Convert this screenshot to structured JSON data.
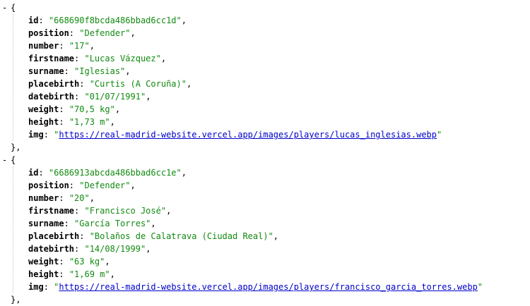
{
  "records": [
    {
      "toggle": "-",
      "open": "{",
      "close": "},",
      "fields": [
        {
          "key": "id",
          "value": "\"668690f8bcda486bbad6cc1d\"",
          "is_link": false
        },
        {
          "key": "position",
          "value": "\"Defender\"",
          "is_link": false
        },
        {
          "key": "number",
          "value": "\"17\"",
          "is_link": false
        },
        {
          "key": "firstname",
          "value": "\"Lucas Vázquez\"",
          "is_link": false
        },
        {
          "key": "surname",
          "value": "\"Iglesias\"",
          "is_link": false
        },
        {
          "key": "placebirth",
          "value": "\"Curtis (A Coruña)\"",
          "is_link": false
        },
        {
          "key": "datebirth",
          "value": "\"01/07/1991\"",
          "is_link": false
        },
        {
          "key": "weight",
          "value": "\"70,5 kg\"",
          "is_link": false
        },
        {
          "key": "height",
          "value": "\"1,73 m\"",
          "is_link": false
        },
        {
          "key": "img",
          "value": "https://real-madrid-website.vercel.app/images/players/lucas_inglesias.webp",
          "is_link": true
        }
      ]
    },
    {
      "toggle": "-",
      "open": "{",
      "close": "},",
      "fields": [
        {
          "key": "id",
          "value": "\"6686913abcda486bbad6cc1e\"",
          "is_link": false
        },
        {
          "key": "position",
          "value": "\"Defender\"",
          "is_link": false
        },
        {
          "key": "number",
          "value": "\"20\"",
          "is_link": false
        },
        {
          "key": "firstname",
          "value": "\"Francisco José\"",
          "is_link": false
        },
        {
          "key": "surname",
          "value": "\"García Torres\"",
          "is_link": false
        },
        {
          "key": "placebirth",
          "value": "\"Bolaños de Calatrava (Ciudad Real)\"",
          "is_link": false
        },
        {
          "key": "datebirth",
          "value": "\"14/08/1999\"",
          "is_link": false
        },
        {
          "key": "weight",
          "value": "\"63 kg\"",
          "is_link": false
        },
        {
          "key": "height",
          "value": "\"1,69 m\"",
          "is_link": false
        },
        {
          "key": "img",
          "value": "https://real-madrid-website.vercel.app/images/players/francisco_garcia_torres.webp",
          "is_link": true
        }
      ]
    }
  ],
  "colors": {
    "string": "#118a11",
    "link": "#0000cc",
    "guide": "#c8c8c8"
  }
}
